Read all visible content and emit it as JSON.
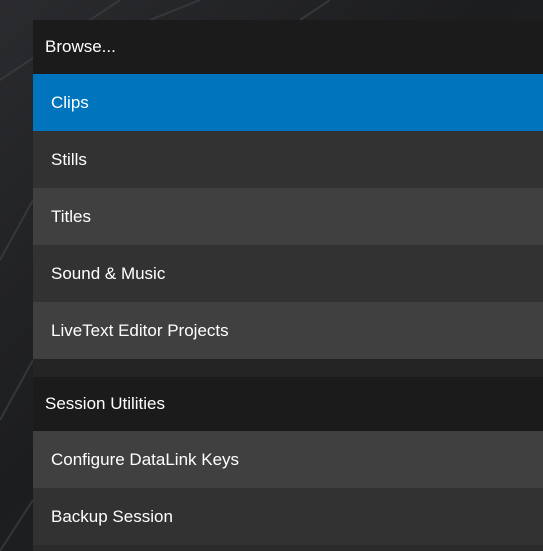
{
  "colors": {
    "selected": "#0074bc",
    "header_bg": "#1b1b1b",
    "row_dark": "#323232",
    "row_light": "#404040",
    "text": "#ffffff"
  },
  "browse": {
    "header": "Browse...",
    "items": [
      {
        "label": "Clips",
        "selected": true
      },
      {
        "label": "Stills",
        "selected": false
      },
      {
        "label": "Titles",
        "selected": false
      },
      {
        "label": "Sound & Music",
        "selected": false
      },
      {
        "label": "LiveText Editor Projects",
        "selected": false
      }
    ]
  },
  "session_utilities": {
    "header": "Session Utilities",
    "items": [
      {
        "label": "Configure DataLink Keys"
      },
      {
        "label": "Backup Session"
      }
    ]
  }
}
